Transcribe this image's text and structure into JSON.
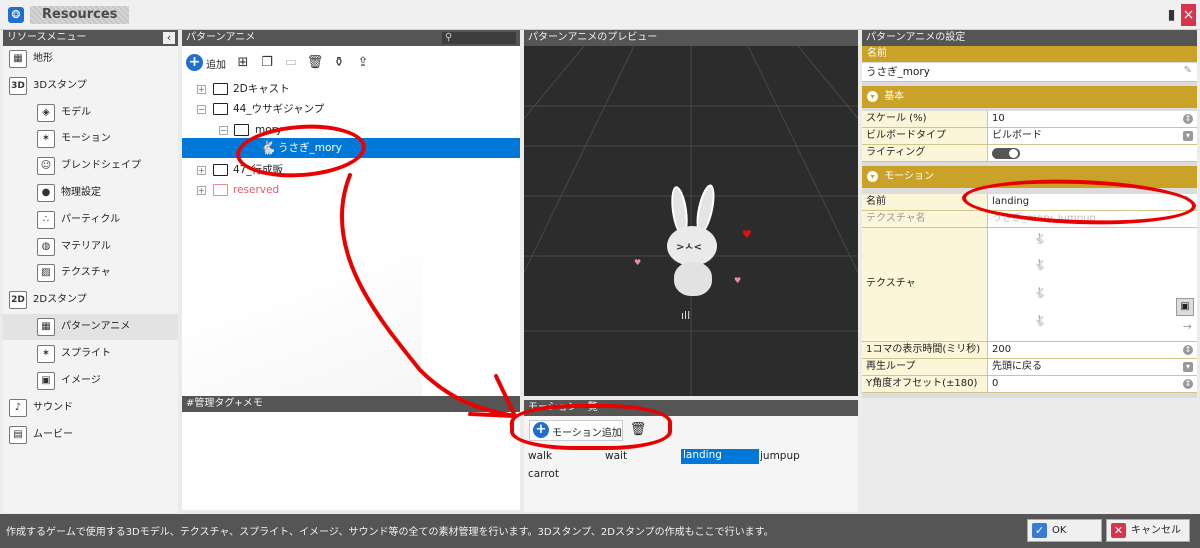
{
  "window": {
    "title": "Resources",
    "minimize_label": "▮",
    "close_label": "×"
  },
  "left_menu": {
    "header": "リソースメニュー",
    "collapse_icon": "‹",
    "items": [
      {
        "label": "地形",
        "icon": "terrain-icon",
        "glyph": "▦"
      },
      {
        "label": "3Dスタンプ",
        "icon": "3d-stamp-icon",
        "glyph": "3D"
      },
      {
        "label": "モデル",
        "icon": "model-icon",
        "glyph": "◈"
      },
      {
        "label": "モーション",
        "icon": "motion-icon",
        "glyph": "✶"
      },
      {
        "label": "ブレンドシェイプ",
        "icon": "blend-shape-icon",
        "glyph": "☺"
      },
      {
        "label": "物理設定",
        "icon": "physics-icon",
        "glyph": "●"
      },
      {
        "label": "パーティクル",
        "icon": "particle-icon",
        "glyph": "∴"
      },
      {
        "label": "マテリアル",
        "icon": "material-icon",
        "glyph": "◍"
      },
      {
        "label": "テクスチャ",
        "icon": "texture-icon",
        "glyph": "▨"
      },
      {
        "label": "2Dスタンプ",
        "icon": "2d-stamp-icon",
        "glyph": "2D"
      },
      {
        "label": "パターンアニメ",
        "icon": "pattern-anime-icon",
        "glyph": "▦"
      },
      {
        "label": "スプライト",
        "icon": "sprite-icon",
        "glyph": "✶"
      },
      {
        "label": "イメージ",
        "icon": "image-icon",
        "glyph": "▣"
      },
      {
        "label": "サウンド",
        "icon": "sound-icon",
        "glyph": "♪"
      },
      {
        "label": "ムービー",
        "icon": "movie-icon",
        "glyph": "▤"
      }
    ]
  },
  "tree": {
    "header": "パターンアニメ",
    "add_label": "追加",
    "items": [
      {
        "label": "2Dキャスト",
        "expander": "+"
      },
      {
        "label": "44_ウサギジャンプ",
        "expander": "−"
      },
      {
        "label": "mory",
        "expander": "−"
      },
      {
        "label": "うさぎ_mory",
        "expander": ""
      },
      {
        "label": "47_行成販",
        "expander": "+"
      },
      {
        "label": "reserved",
        "expander": "+"
      }
    ]
  },
  "memo": {
    "header": "#管理タグ+メモ"
  },
  "preview": {
    "header": "パターンアニメのプレビュー"
  },
  "motion_list": {
    "header": "モーション一覧",
    "add_label": "モーション追加",
    "items": [
      "walk",
      "wait",
      "landing",
      "jumpup",
      "carrot"
    ],
    "selected": "landing"
  },
  "settings": {
    "header": "パターンアニメの設定",
    "name_label": "名前",
    "name_value": "うさぎ_mory",
    "basic_label": "基本",
    "scale_label": "スケール (%)",
    "scale_value": "10",
    "billboard_label": "ビルボードタイプ",
    "billboard_value": "ビルボード",
    "lighting_label": "ライティング",
    "motion_section_label": "モーション",
    "motion_name_label": "名前",
    "motion_name_value": "landing",
    "texture_name_label": "テクスチャ名",
    "texture_name_value": "うさぎ_mory_jumpup",
    "texture_label": "テクスチャ",
    "frame_time_label": "1コマの表示時間(ミリ秒)",
    "frame_time_value": "200",
    "loop_label": "再生ループ",
    "loop_value": "先頭に戻る",
    "y_offset_label": "Y角度オフセット(±180)",
    "y_offset_value": "0"
  },
  "status": {
    "text": "作成するゲームで使用する3Dモデル、テクスチャ、スプライト、イメージ、サウンド等の全ての素材管理を行います。3Dスタンプ、2Dスタンプの作成もここで行います。",
    "ok_label": "OK",
    "cancel_label": "キャンセル"
  },
  "colors": {
    "accent": "#0078d7",
    "section": "#c9a227",
    "annotation": "#ea0000"
  }
}
